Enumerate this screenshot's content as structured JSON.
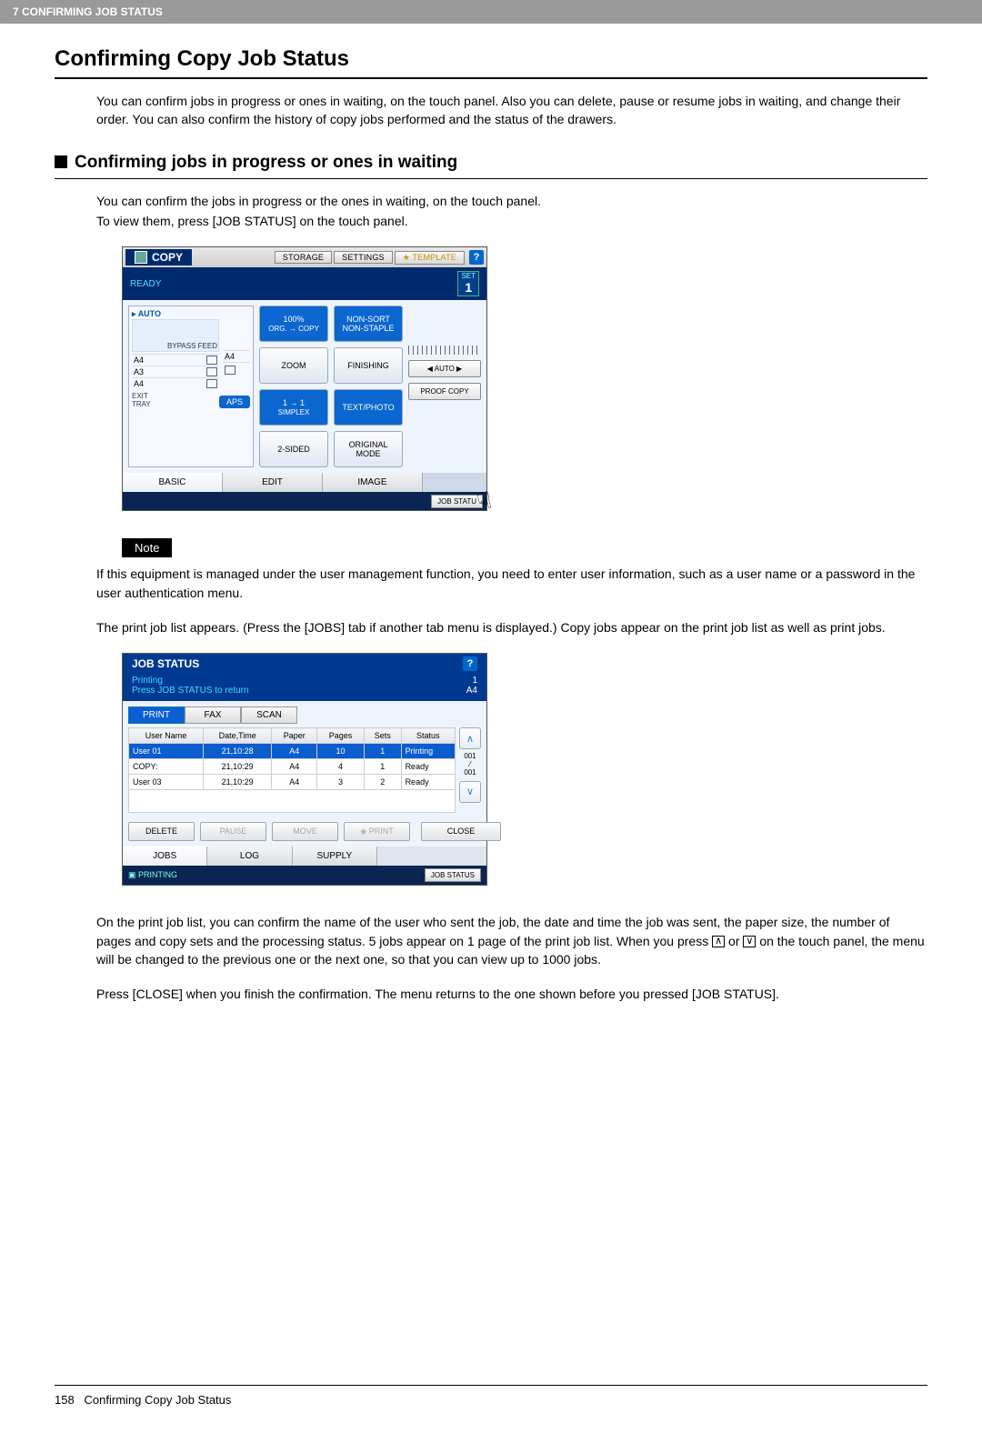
{
  "header_bar": "7 CONFIRMING JOB STATUS",
  "h1": "Confirming Copy Job Status",
  "intro": "You can confirm jobs in progress or ones in waiting, on the touch panel. Also you can delete, pause or resume jobs in waiting, and change their order. You can also confirm the history of copy jobs performed and the status of the drawers.",
  "h2": "Confirming jobs in progress or ones in waiting",
  "h2_p1": "You can confirm the jobs in progress or the ones in waiting, on the touch panel.",
  "h2_p2": "To view them, press [JOB STATUS] on the touch panel.",
  "copy_screen": {
    "title": "COPY",
    "storage": "STORAGE",
    "settings": "SETTINGS",
    "template": "TEMPLATE",
    "ready": "READY",
    "set_label": "SET",
    "set_value": "1",
    "auto": "AUTO",
    "bypass": "BYPASS FEED",
    "slots": [
      "A4",
      "A3",
      "A4"
    ],
    "side_slots": [
      "A4",
      ""
    ],
    "exit": "EXIT TRAY",
    "aps": "APS",
    "zoom_top": "100%",
    "zoom_sub": "ORG.  → COPY",
    "zoom": "ZOOM",
    "simplex_top": "1 → 1",
    "simplex": "SIMPLEX",
    "twosided": "2-SIDED",
    "nonsort": "NON-SORT NON-STAPLE",
    "finishing": "FINISHING",
    "textphoto": "TEXT/PHOTO",
    "original": "ORIGINAL MODE",
    "auto_exp": "AUTO",
    "proof": "PROOF COPY",
    "tabs": [
      "BASIC",
      "EDIT",
      "IMAGE"
    ],
    "jobstatus": "JOB STATU"
  },
  "note_label": "Note",
  "note_text": "If this equipment is managed under the user management function, you need to enter user information, such as a user name or a password in the user authentication menu.",
  "joblist_intro": "The print job list appears. (Press the [JOBS] tab if another tab menu is displayed.) Copy jobs appear on the print job list as well as print jobs.",
  "job_screen": {
    "title": "JOB STATUS",
    "printing": "Printing",
    "hint": "Press JOB STATUS to return",
    "count": "1",
    "paper": "A4",
    "tabs": [
      "PRINT",
      "FAX",
      "SCAN"
    ],
    "cols": [
      "User Name",
      "Date,Time",
      "Paper",
      "Pages",
      "Sets",
      "Status"
    ],
    "rows": [
      {
        "user": "User 01",
        "dt": "21,10:28",
        "paper": "A4",
        "pages": "10",
        "sets": "1",
        "status": "Printing",
        "sel": true
      },
      {
        "user": "COPY:",
        "dt": "21,10:29",
        "paper": "A4",
        "pages": "4",
        "sets": "1",
        "status": "Ready",
        "sel": false
      },
      {
        "user": "User 03",
        "dt": "21,10:29",
        "paper": "A4",
        "pages": "3",
        "sets": "2",
        "status": "Ready",
        "sel": false
      }
    ],
    "page_ind_top": "001",
    "page_ind_bot": "001",
    "actions": {
      "delete": "DELETE",
      "pause": "PAUSE",
      "move": "MOVE",
      "print": "PRINT",
      "close": "CLOSE"
    },
    "bottom_tabs": [
      "JOBS",
      "LOG",
      "SUPPLY"
    ],
    "footer_printing": "PRINTING",
    "footer_jobstatus": "JOB STATUS"
  },
  "after1a": "On the print job list, you can confirm the name of the user who sent the job, the date and time the job was sent, the paper size, the number of pages and copy sets and the processing status. 5 jobs appear on 1 page of the print job list. When you press ",
  "after1b": " or ",
  "after1c": " on the touch panel, the menu will be changed to the previous one or the next one, so that you can view up to 1000 jobs.",
  "after2": "Press [CLOSE] when you finish the confirmation. The menu returns to the one shown before you pressed [JOB STATUS].",
  "footer_page": "158",
  "footer_title": "Confirming Copy Job Status"
}
